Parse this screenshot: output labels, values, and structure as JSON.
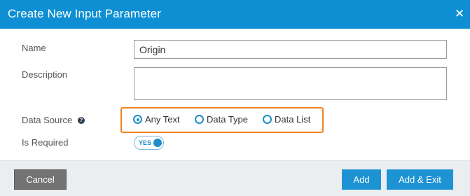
{
  "dialog": {
    "title": "Create New Input Parameter",
    "close_glyph": "✕"
  },
  "form": {
    "name": {
      "label": "Name",
      "value": "Origin"
    },
    "description": {
      "label": "Description",
      "value": ""
    },
    "data_source": {
      "label": "Data Source",
      "help_icon": "question-circle-icon",
      "help_glyph": "?",
      "options": [
        {
          "label": "Any Text",
          "selected": true
        },
        {
          "label": "Data Type",
          "selected": false
        },
        {
          "label": "Data List",
          "selected": false
        }
      ]
    },
    "is_required": {
      "label": "Is Required",
      "toggle_text": "YES",
      "value": true
    }
  },
  "footer": {
    "cancel_label": "Cancel",
    "add_label": "Add",
    "add_exit_label": "Add & Exit"
  },
  "colors": {
    "header_bg": "#0e8fd3",
    "accent": "#1f8dc6",
    "highlight_border": "#f0821e",
    "cancel_bg": "#737373"
  }
}
